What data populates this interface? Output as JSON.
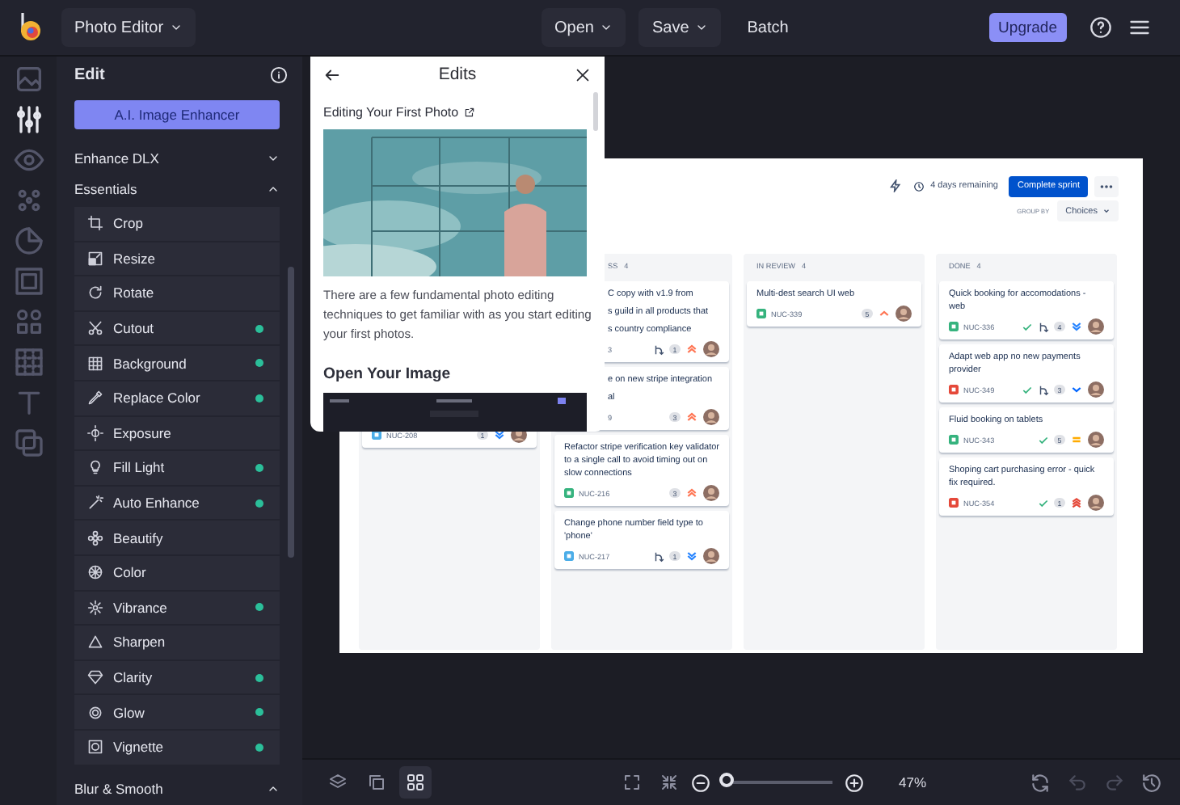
{
  "topbar": {
    "app_menu": {
      "label": "Photo Editor",
      "caret": true
    },
    "menus": [
      {
        "label": "Open",
        "caret": true
      },
      {
        "label": "Save",
        "caret": true
      },
      {
        "label": "Batch",
        "caret": false
      }
    ],
    "upgrade": "Upgrade"
  },
  "rail": [
    {
      "selected": false
    },
    {
      "selected": true
    },
    {
      "selected": false
    },
    {
      "selected": false
    },
    {
      "selected": false
    },
    {
      "selected": false
    },
    {
      "selected": false
    },
    {
      "selected": false
    },
    {
      "selected": false
    },
    {
      "selected": false
    }
  ],
  "panel": {
    "title": "Edit",
    "enhancer_button": "A.I. Image Enhancer",
    "sections": [
      {
        "label": "Enhance DLX",
        "expanded": false
      },
      {
        "label": "Essentials",
        "expanded": true,
        "items": [
          {
            "label": "Crop",
            "dot": false
          },
          {
            "label": "Resize",
            "dot": false
          },
          {
            "label": "Rotate",
            "dot": false
          },
          {
            "label": "Cutout",
            "dot": true
          },
          {
            "label": "Background",
            "dot": true
          },
          {
            "label": "Replace Color",
            "dot": true
          },
          {
            "label": "Exposure",
            "dot": false
          },
          {
            "label": "Fill Light",
            "dot": true
          },
          {
            "label": "Auto Enhance",
            "dot": true
          },
          {
            "label": "Beautify",
            "dot": false
          },
          {
            "label": "Color",
            "dot": false
          },
          {
            "label": "Vibrance",
            "dot": true
          },
          {
            "label": "Sharpen",
            "dot": false
          },
          {
            "label": "Clarity",
            "dot": true
          },
          {
            "label": "Glow",
            "dot": true
          },
          {
            "label": "Vignette",
            "dot": true
          }
        ]
      },
      {
        "label": "Blur & Smooth",
        "expanded": true
      }
    ]
  },
  "edits_popup": {
    "title": "Edits",
    "article_title": "Editing Your First Photo",
    "paragraph": "There are a few fundamental photo editing techniques to get familiar with as you start editing your first photos.",
    "section_title": "Open Your Image"
  },
  "board": {
    "remaining": "4 days remaining",
    "complete_button": "Complete sprint",
    "group_by_label": "GROUP BY",
    "group_by_value": "Choices",
    "columns": [
      {
        "kind": "hidden",
        "cards": [
          {
            "kind": "footer_only",
            "id": "NUC-208",
            "type_icon": {
              "color": "#4bade8"
            },
            "badge": "1",
            "priority": {
              "kind": "double_down",
              "color": "#2684ff"
            },
            "resolved": false,
            "branch": false
          }
        ]
      },
      {
        "kind": "covered",
        "name": "SS",
        "count": "4",
        "cards": [
          {
            "kind": "covered",
            "lines": [
              "C copy with v1.9 from",
              "s guild in all products that",
              "s country compliance"
            ],
            "id": "3",
            "badge": "1",
            "priority": {
              "kind": "double_up",
              "color": "#ff7452"
            },
            "resolved": false,
            "branch": true
          },
          {
            "kind": "covered",
            "lines": [
              "e on new stripe integration",
              "al"
            ],
            "id": "9",
            "badge": "3",
            "priority": {
              "kind": "double_up",
              "color": "#ff7452"
            },
            "resolved": false,
            "branch": false
          },
          {
            "kind": "card",
            "title": "Refactor stripe verification key validator to a single call to avoid timing out on slow connections",
            "id": "NUC-216",
            "type_icon": {
              "color": "#36b37e"
            },
            "badge": "3",
            "priority": {
              "kind": "double_up",
              "color": "#ff7452"
            },
            "resolved": false,
            "branch": false
          },
          {
            "kind": "card",
            "title": "Change phone number field type to 'phone'",
            "id": "NUC-217",
            "type_icon": {
              "color": "#4bade8"
            },
            "badge": "1",
            "priority": {
              "kind": "double_down",
              "color": "#2684ff"
            },
            "resolved": false,
            "branch": true
          }
        ]
      },
      {
        "kind": "open",
        "name": "IN REVIEW",
        "count": "4",
        "cards": [
          {
            "kind": "card",
            "title": "Multi-dest search UI web",
            "id": "NUC-339",
            "type_icon": {
              "color": "#36b37e"
            },
            "badge": "5",
            "priority": {
              "kind": "up",
              "color": "#ff7452"
            },
            "resolved": false,
            "branch": false
          }
        ]
      },
      {
        "kind": "open",
        "name": "DONE",
        "count": "4",
        "cards": [
          {
            "kind": "card",
            "title": "Quick booking for accomodations - web",
            "id": "NUC-336",
            "type_icon": {
              "color": "#36b37e"
            },
            "badge": "4",
            "priority": {
              "kind": "double_down",
              "color": "#2684ff"
            },
            "resolved": true,
            "branch": true
          },
          {
            "kind": "card",
            "title": "Adapt web app no new payments provider",
            "id": "NUC-349",
            "type_icon": {
              "color": "#e5493a"
            },
            "badge": "3",
            "priority": {
              "kind": "down",
              "color": "#0065ff"
            },
            "resolved": true,
            "branch": true
          },
          {
            "kind": "card",
            "title": "Fluid booking on tablets",
            "id": "NUC-343",
            "type_icon": {
              "color": "#36b37e"
            },
            "badge": "5",
            "priority": {
              "kind": "equals",
              "color": "#ffab00"
            },
            "resolved": true,
            "branch": false
          },
          {
            "kind": "card",
            "title": "Shoping cart purchasing error - quick fix required.",
            "id": "NUC-354",
            "type_icon": {
              "color": "#e5493a"
            },
            "badge": "1",
            "priority": {
              "kind": "triple_up",
              "color": "#e5493a"
            },
            "resolved": true,
            "branch": false
          }
        ]
      }
    ]
  },
  "bottom_bar": {
    "view_tools": [
      {
        "selected": false
      },
      {
        "selected": false
      },
      {
        "selected": true
      }
    ],
    "zoom": {
      "level": 0.04,
      "reading": "47%"
    },
    "history_tools": [
      {
        "disabled": false
      },
      {
        "disabled": true
      },
      {
        "disabled": true
      },
      {
        "disabled": false
      }
    ]
  }
}
